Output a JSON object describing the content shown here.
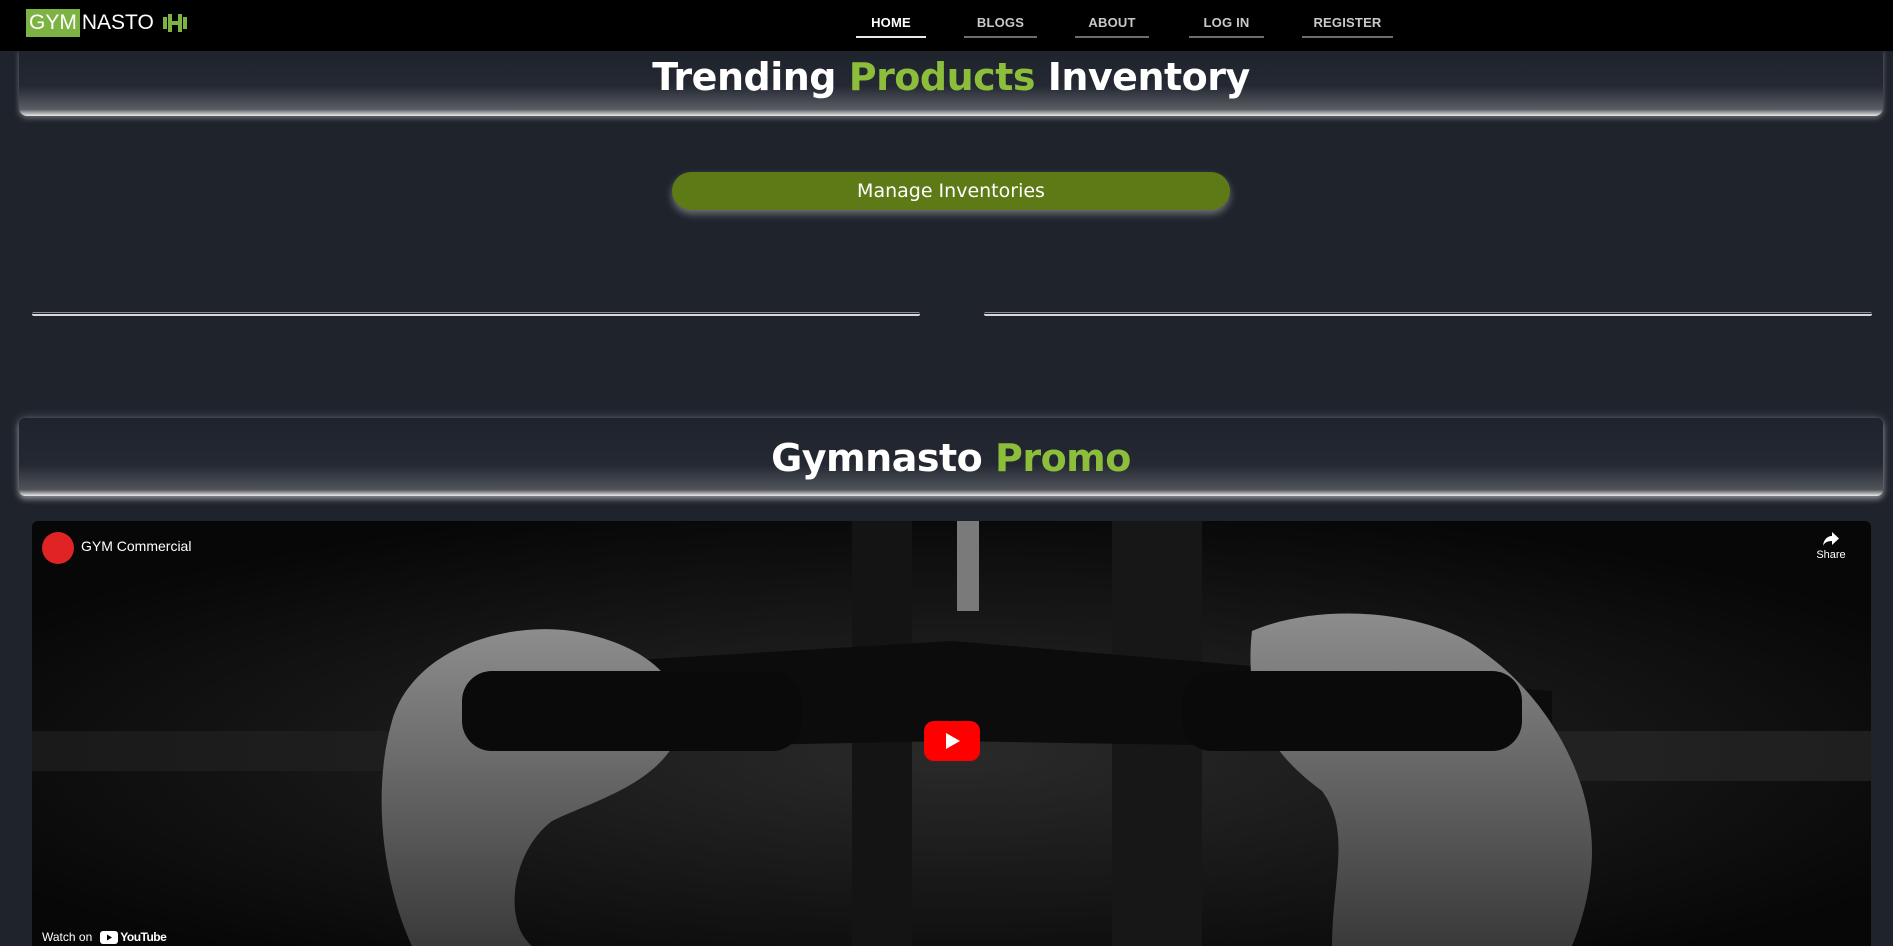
{
  "brand": {
    "part1": "GYM",
    "part2": "NASTO",
    "icon": "dumbbell-icon"
  },
  "nav": {
    "items": [
      {
        "label": "HOME",
        "active": true
      },
      {
        "label": "BLOGS",
        "active": false
      },
      {
        "label": "ABOUT",
        "active": false
      },
      {
        "label": "LOG IN",
        "active": false
      },
      {
        "label": "REGISTER",
        "active": false
      }
    ]
  },
  "trending": {
    "word1": "Trending",
    "word2": "Products",
    "word3": "Inventory"
  },
  "manage_button": {
    "label": "Manage Inventories"
  },
  "promo": {
    "word1": "Gymnasto",
    "word2": "Promo"
  },
  "video": {
    "title": "GYM Commercial",
    "share_label": "Share",
    "watch_on": "Watch on",
    "platform": "YouTube"
  },
  "colors": {
    "accent": "#8cbe3c",
    "button": "#5d7a17",
    "background": "#1f232c",
    "navbar": "#000000"
  }
}
